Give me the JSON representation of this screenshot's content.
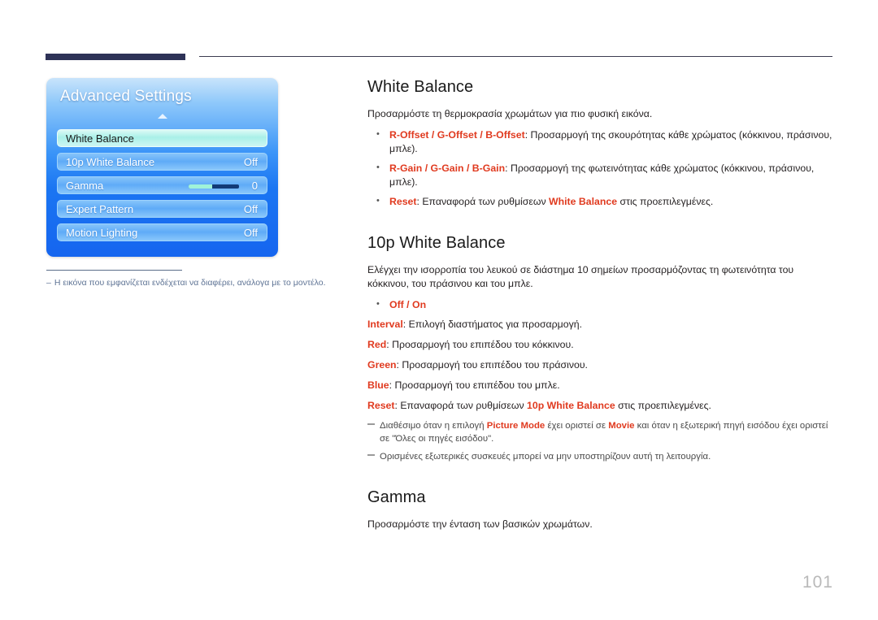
{
  "page": {
    "number": "101"
  },
  "osd": {
    "title": "Advanced Settings",
    "scroll_up_icon": "triangle-up-icon",
    "rows": [
      {
        "label": "White Balance",
        "value": "",
        "selected": true,
        "has_slider": false
      },
      {
        "label": "10p White Balance",
        "value": "Off",
        "selected": false,
        "has_slider": false
      },
      {
        "label": "Gamma",
        "value": "0",
        "selected": false,
        "has_slider": true
      },
      {
        "label": "Expert Pattern",
        "value": "Off",
        "selected": false,
        "has_slider": false
      },
      {
        "label": "Motion Lighting",
        "value": "Off",
        "selected": false,
        "has_slider": false
      }
    ],
    "note_dash": "–",
    "note": "Η εικόνα που εμφανίζεται ενδέχεται να διαφέρει, ανάλογα με το μοντέλο."
  },
  "content": {
    "section1": {
      "title": "White Balance",
      "intro": "Προσαρμόστε τη θερμοκρασία χρωμάτων για πιο φυσική εικόνα.",
      "bullet1_terms": "R-Offset / G-Offset / B-Offset",
      "bullet1_text": ": Προσαρμογή της σκουρότητας κάθε χρώματος (κόκκινου, πράσινου, μπλε).",
      "bullet2_terms": "R-Gain / G-Gain / B-Gain",
      "bullet2_text": ": Προσαρμογή της φωτεινότητας κάθε χρώματος (κόκκινου, πράσινου, μπλε).",
      "bullet3_term": "Reset",
      "bullet3_text_a": ": Επαναφορά των ρυθμίσεων ",
      "bullet3_term_b": "White Balance",
      "bullet3_text_b": " στις προεπιλεγμένες."
    },
    "section2": {
      "title": "10p White Balance",
      "intro": "Ελέγχει την ισορροπία του λευκού σε διάστημα 10 σημείων προσαρμόζοντας τη φωτεινότητα του κόκκινου, του πράσινου και του μπλε.",
      "bullet_offon": "Off / On",
      "line_interval_term": "Interval",
      "line_interval_text": ": Επιλογή διαστήματος για προσαρμογή.",
      "line_red_term": "Red",
      "line_red_text": ": Προσαρμογή του επιπέδου του κόκκινου.",
      "line_green_term": "Green",
      "line_green_text": ": Προσαρμογή του επιπέδου του πράσινου.",
      "line_blue_term": "Blue",
      "line_blue_text": ": Προσαρμογή του επιπέδου του μπλε.",
      "line_reset_term": "Reset",
      "line_reset_text_a": ": Επαναφορά των ρυθμίσεων ",
      "line_reset_term_b": "10p White Balance",
      "line_reset_text_b": " στις προεπιλεγμένες.",
      "note1_a": "Διαθέσιμο όταν η επιλογή ",
      "note1_term1": "Picture Mode",
      "note1_b": " έχει οριστεί σε ",
      "note1_term2": "Movie",
      "note1_c": " και όταν η εξωτερική πηγή εισόδου έχει οριστεί σε \"Όλες οι πηγές εισόδου\".",
      "note2": "Ορισμένες εξωτερικές συσκευές μπορεί να μην υποστηρίζουν αυτή τη λειτουργία."
    },
    "section3": {
      "title": "Gamma",
      "intro": "Προσαρμόστε την ένταση των βασικών χρωμάτων."
    }
  },
  "colors": {
    "accent_term": "#e03a1f",
    "rule_navy": "#2e3257",
    "osd_blue": "#1a75f2",
    "note_blue": "#5f7495",
    "page_number": "#b9b9b9"
  }
}
